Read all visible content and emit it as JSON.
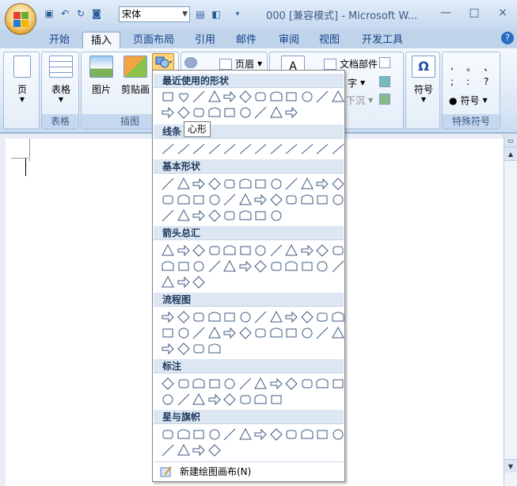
{
  "window": {
    "title": "000 [兼容模式] - Microsoft W...",
    "font_name": "宋体",
    "controls": [
      "—",
      "□",
      "×"
    ]
  },
  "tabs": [
    "开始",
    "插入",
    "页面布局",
    "引用",
    "邮件",
    "审阅",
    "视图",
    "开发工具"
  ],
  "active_tab": "插入",
  "ribbon": {
    "groups": {
      "pages": {
        "button": "页",
        "label": ""
      },
      "tables": {
        "button": "表格",
        "label": "表格"
      },
      "illustrations": {
        "picture": "图片",
        "clipart": "剪贴画",
        "label": "插图"
      },
      "header_footer": {
        "header": "页眉"
      },
      "text": {
        "docparts": "文档部件",
        "wordart": "字",
        "dropcap": "下沉"
      },
      "symbols": {
        "symbol": "符号",
        "special_symbol": "符号",
        "label": "特殊符号"
      }
    },
    "special_chars": [
      ",",
      "。",
      "、",
      ";",
      ":",
      "?"
    ]
  },
  "shapes_menu": {
    "sections": [
      {
        "title": "最近使用的形状",
        "count": 21
      },
      {
        "title": "线条",
        "count": 12
      },
      {
        "title": "基本形状",
        "count": 32
      },
      {
        "title": "箭头总汇",
        "count": 27
      },
      {
        "title": "流程图",
        "count": 28
      },
      {
        "title": "标注",
        "count": 20
      },
      {
        "title": "星与旗帜",
        "count": 16
      }
    ],
    "tooltip": "心形",
    "footer": "新建绘图画布(N)"
  }
}
